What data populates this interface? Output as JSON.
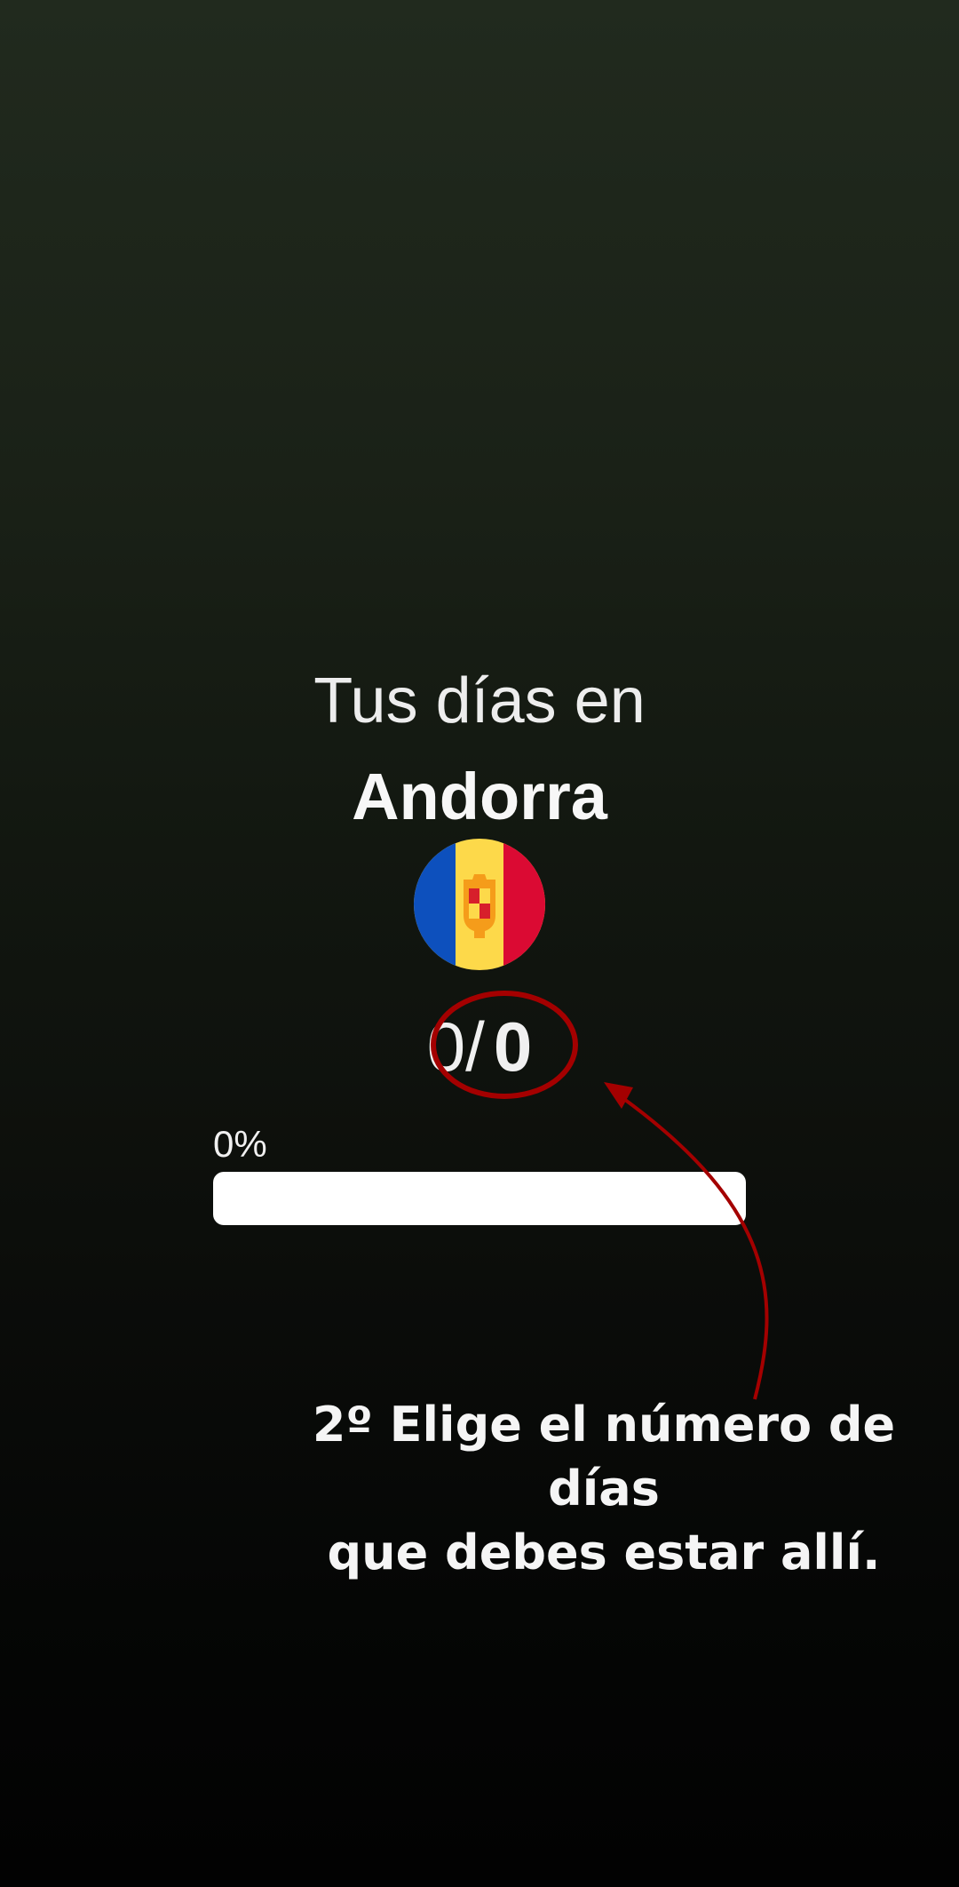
{
  "header": {
    "line1": "Tus días en",
    "country": "Andorra"
  },
  "flag": {
    "icon": "andorra-flag-icon",
    "colors": {
      "blue": "#0d50bd",
      "yellow": "#fdd94a",
      "red": "#db0a33",
      "shield": "#f59c1a",
      "shield_red": "#d71f2b"
    }
  },
  "counter": {
    "current": "0",
    "separator": "/",
    "total": "0"
  },
  "progress": {
    "label": "0%",
    "value": 0
  },
  "annotation": {
    "line1": "2º Elige el número de días",
    "line2": "que debes estar allí.",
    "color": "#a40000"
  }
}
